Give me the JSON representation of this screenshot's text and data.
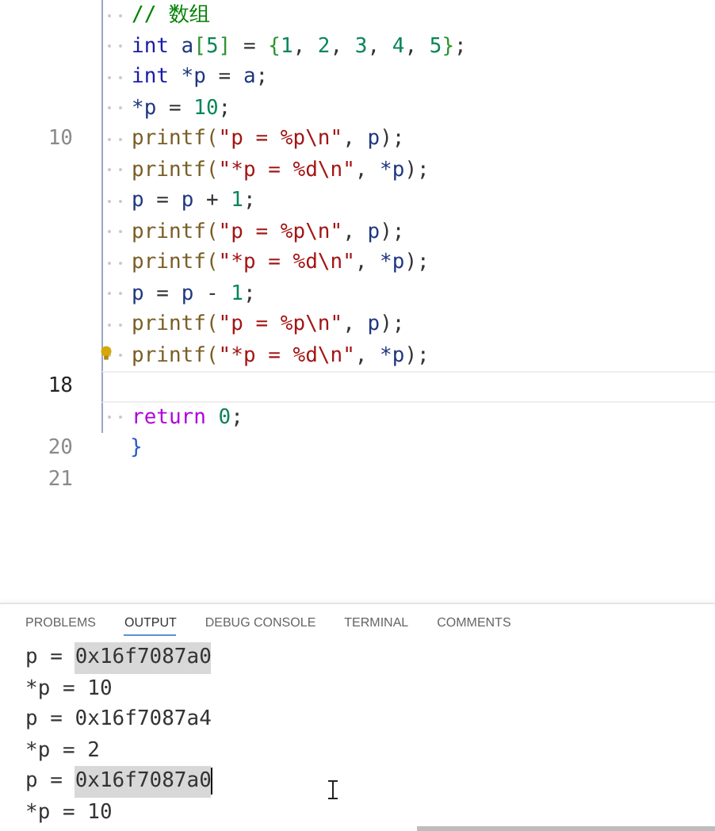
{
  "editor": {
    "lines": [
      {
        "indented": true,
        "current": false,
        "lightbulb": false,
        "tokens": [
          {
            "kind": "comment",
            "text": "// 数组"
          }
        ]
      },
      {
        "indented": true,
        "current": false,
        "lightbulb": false,
        "tokens": [
          {
            "kind": "keyword",
            "text": "int"
          },
          {
            "kind": "ident",
            "text": " a"
          },
          {
            "kind": "bracket",
            "text": "["
          },
          {
            "kind": "number",
            "text": "5"
          },
          {
            "kind": "bracket",
            "text": "]"
          },
          {
            "kind": "punct",
            "text": " = "
          },
          {
            "kind": "bracket",
            "text": "{"
          },
          {
            "kind": "number",
            "text": "1"
          },
          {
            "kind": "punct",
            "text": ", "
          },
          {
            "kind": "number",
            "text": "2"
          },
          {
            "kind": "punct",
            "text": ", "
          },
          {
            "kind": "number",
            "text": "3"
          },
          {
            "kind": "punct",
            "text": ", "
          },
          {
            "kind": "number",
            "text": "4"
          },
          {
            "kind": "punct",
            "text": ", "
          },
          {
            "kind": "number",
            "text": "5"
          },
          {
            "kind": "bracket",
            "text": "}"
          },
          {
            "kind": "punct",
            "text": ";"
          }
        ]
      },
      {
        "indented": true,
        "current": false,
        "lightbulb": false,
        "tokens": [
          {
            "kind": "keyword",
            "text": "int"
          },
          {
            "kind": "ident",
            "text": " *p"
          },
          {
            "kind": "punct",
            "text": " = "
          },
          {
            "kind": "ident",
            "text": "a"
          },
          {
            "kind": "punct",
            "text": ";"
          }
        ]
      },
      {
        "indented": true,
        "current": false,
        "lightbulb": false,
        "tokens": [
          {
            "kind": "ident",
            "text": "*p"
          },
          {
            "kind": "punct",
            "text": " = "
          },
          {
            "kind": "number",
            "text": "10"
          },
          {
            "kind": "punct",
            "text": ";"
          }
        ]
      },
      {
        "number": "10",
        "indented": true,
        "current": false,
        "lightbulb": false,
        "tokens": [
          {
            "kind": "func",
            "text": "printf("
          },
          {
            "kind": "string",
            "text": "\"p = %p\\n\""
          },
          {
            "kind": "punct",
            "text": ", "
          },
          {
            "kind": "ident",
            "text": "p"
          },
          {
            "kind": "punct",
            "text": ");"
          }
        ]
      },
      {
        "indented": true,
        "current": false,
        "lightbulb": false,
        "tokens": [
          {
            "kind": "func",
            "text": "printf("
          },
          {
            "kind": "string",
            "text": "\"*p = %d\\n\""
          },
          {
            "kind": "punct",
            "text": ", "
          },
          {
            "kind": "ident",
            "text": "*p"
          },
          {
            "kind": "punct",
            "text": ");"
          }
        ]
      },
      {
        "indented": true,
        "current": false,
        "lightbulb": false,
        "tokens": [
          {
            "kind": "ident",
            "text": "p"
          },
          {
            "kind": "punct",
            "text": " = "
          },
          {
            "kind": "ident",
            "text": "p"
          },
          {
            "kind": "punct",
            "text": " + "
          },
          {
            "kind": "number",
            "text": "1"
          },
          {
            "kind": "punct",
            "text": ";"
          }
        ]
      },
      {
        "indented": true,
        "current": false,
        "lightbulb": false,
        "tokens": [
          {
            "kind": "func",
            "text": "printf("
          },
          {
            "kind": "string",
            "text": "\"p = %p\\n\""
          },
          {
            "kind": "punct",
            "text": ", "
          },
          {
            "kind": "ident",
            "text": "p"
          },
          {
            "kind": "punct",
            "text": ");"
          }
        ]
      },
      {
        "indented": true,
        "current": false,
        "lightbulb": false,
        "tokens": [
          {
            "kind": "func",
            "text": "printf("
          },
          {
            "kind": "string",
            "text": "\"*p = %d\\n\""
          },
          {
            "kind": "punct",
            "text": ", "
          },
          {
            "kind": "ident",
            "text": "*p"
          },
          {
            "kind": "punct",
            "text": ");"
          }
        ]
      },
      {
        "indented": true,
        "current": false,
        "lightbulb": false,
        "tokens": [
          {
            "kind": "ident",
            "text": "p"
          },
          {
            "kind": "punct",
            "text": " = "
          },
          {
            "kind": "ident",
            "text": "p"
          },
          {
            "kind": "punct",
            "text": " - "
          },
          {
            "kind": "number",
            "text": "1"
          },
          {
            "kind": "punct",
            "text": ";"
          }
        ]
      },
      {
        "indented": true,
        "current": false,
        "lightbulb": false,
        "tokens": [
          {
            "kind": "func",
            "text": "printf("
          },
          {
            "kind": "string",
            "text": "\"p = %p\\n\""
          },
          {
            "kind": "punct",
            "text": ", "
          },
          {
            "kind": "ident",
            "text": "p"
          },
          {
            "kind": "punct",
            "text": ");"
          }
        ]
      },
      {
        "indented": true,
        "current": false,
        "lightbulb": true,
        "tokens": [
          {
            "kind": "func",
            "text": "printf("
          },
          {
            "kind": "string",
            "text": "\"*p = %d\\n\""
          },
          {
            "kind": "punct",
            "text": ", "
          },
          {
            "kind": "ident",
            "text": "*p"
          },
          {
            "kind": "punct",
            "text": ");"
          }
        ]
      },
      {
        "number": "18",
        "indented": false,
        "current": true,
        "lightbulb": false
      },
      {
        "indented": true,
        "current": false,
        "lightbulb": false,
        "tokens": [
          {
            "kind": "control",
            "text": "return"
          },
          {
            "kind": "number",
            "text": " 0"
          },
          {
            "kind": "punct",
            "text": ";"
          }
        ]
      },
      {
        "number": "20",
        "indented": false,
        "current": false,
        "lightbulb": false,
        "tokens": [
          {
            "kind": "bracket2",
            "text": "}"
          }
        ]
      },
      {
        "number": "21",
        "indented": false,
        "current": false,
        "lightbulb": false
      }
    ]
  },
  "panel": {
    "tabs": [
      {
        "label": "PROBLEMS",
        "selected": false
      },
      {
        "label": "OUTPUT",
        "selected": true
      },
      {
        "label": "DEBUG CONSOLE",
        "selected": false
      },
      {
        "label": "TERMINAL",
        "selected": false
      },
      {
        "label": "COMMENTS",
        "selected": false
      }
    ],
    "output": [
      {
        "caret": false,
        "segments": [
          {
            "text": "p = ",
            "selected": false
          },
          {
            "text": "0x16f7087a0",
            "selected": true
          }
        ]
      },
      {
        "caret": false,
        "segments": [
          {
            "text": "*p = 10",
            "selected": false
          }
        ]
      },
      {
        "caret": false,
        "segments": [
          {
            "text": "p = 0x16f7087a4",
            "selected": false
          }
        ]
      },
      {
        "caret": false,
        "segments": [
          {
            "text": "*p = 2",
            "selected": false
          }
        ]
      },
      {
        "caret": true,
        "segments": [
          {
            "text": "p = ",
            "selected": false
          },
          {
            "text": "0x16f7087a0",
            "selected": true
          }
        ]
      },
      {
        "caret": false,
        "segments": [
          {
            "text": "*p = 10",
            "selected": false
          }
        ]
      }
    ]
  }
}
